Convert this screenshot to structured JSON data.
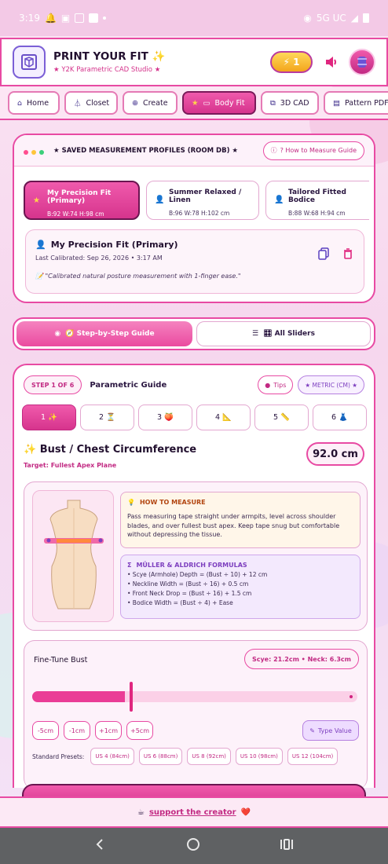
{
  "status": {
    "time": "3:19",
    "network": "5G UC"
  },
  "header": {
    "title": "PRINT YOUR FIT ✨",
    "subtitle": "★ Y2K Parametric CAD Studio ★",
    "bolt_label": "⚡ 1"
  },
  "nav": {
    "tabs": [
      {
        "label": "Home"
      },
      {
        "label": "Closet"
      },
      {
        "label": "Create"
      },
      {
        "label": "Body Fit"
      },
      {
        "label": "3D CAD"
      },
      {
        "label": "Pattern PDF"
      }
    ]
  },
  "profiles_card": {
    "title": "★ SAVED MEASUREMENT PROFILES (ROOM DB) ★",
    "guide_label": "? How to Measure Guide",
    "profiles": [
      {
        "name": "My Precision Fit (Primary)",
        "meas": "B:92 W:74 H:98 cm"
      },
      {
        "name": "Summer Relaxed / Linen",
        "meas": "B:96 W:78 H:102 cm"
      },
      {
        "name": "Tailored Fitted Bodice",
        "meas": "B:88 W:68 H:94 cm"
      }
    ],
    "detail": {
      "name": "My Precision Fit (Primary)",
      "calibrated": "Last Calibrated: Sep 26, 2026 • 3:17 AM",
      "note": "📝 \"Calibrated natural posture measurement with 1-finger ease.\""
    }
  },
  "mode_toggle": {
    "guide": "🧭 Step-by-Step Guide",
    "sliders": "🎛 All Sliders"
  },
  "guide": {
    "step_label": "STEP 1 OF 6",
    "title": "Parametric Guide",
    "tips": "Tips",
    "metric": "★ METRIC (CM) ★",
    "steps": [
      "1 ✨",
      "2 ⏳",
      "3 🍑",
      "4 📐",
      "5 📏",
      "6 👗"
    ],
    "measure_title": "✨ Bust / Chest Circumference",
    "target": "Target: Fullest Apex Plane",
    "value": "92.0 cm",
    "how_title": "HOW TO MEASURE",
    "how_text": "Pass measuring tape straight under armpits, level across shoulder blades, and over fullest bust apex. Keep tape snug but comfortable without depressing the tissue.",
    "formula_title": "MÜLLER & ALDRICH FORMULAS",
    "formulas": [
      "• Scye (Armhole) Depth = (Bust ÷ 10) + 12 cm",
      "• Neckline Width = (Bust ÷ 16) + 0.5 cm",
      "• Front Neck Drop = (Bust ÷ 16) + 1.5 cm",
      "• Bodice Width = (Bust ÷ 4) + Ease"
    ],
    "fine_title": "Fine-Tune Bust",
    "fine_stats": "Scye: 21.2cm • Neck: 6.3cm",
    "slider_fraction": 0.3,
    "step_buttons": [
      "-5cm",
      "-1cm",
      "+1cm",
      "+5cm"
    ],
    "type_value": "Type Value",
    "presets_label": "Standard Presets:",
    "presets": [
      "US 4 (84cm)",
      "US 6 (88cm)",
      "US 8 (92cm)",
      "US 10 (98cm)",
      "US 12 (104cm)"
    ]
  },
  "footer": {
    "cup": "☕",
    "link": "support the creator",
    "heart": "❤️"
  },
  "colors": {
    "accent": "#e84aa3",
    "purple": "#7d3fbf"
  }
}
